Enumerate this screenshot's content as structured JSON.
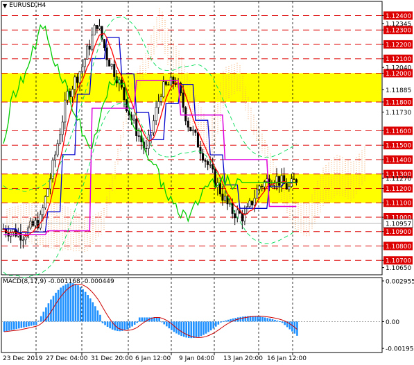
{
  "header": {
    "symbol_label": "EURUSD,H4",
    "dropdown_icon": "triangle-down-icon"
  },
  "price_axis": {
    "ymin": 1.106,
    "ymax": 1.1246,
    "levels": [
      1.124,
      1.123,
      1.122,
      1.121,
      1.12,
      1.118,
      1.116,
      1.115,
      1.114,
      1.113,
      1.112,
      1.111,
      1.11,
      1.109,
      1.108,
      1.107
    ],
    "level_labels": [
      "1.12400",
      "1.12300",
      "1.12200",
      "1.12100",
      "1.12000",
      "1.11800",
      "1.11600",
      "1.11500",
      "1.11400",
      "1.11300",
      "1.11200",
      "1.11100",
      "1.11000",
      "1.10900",
      "1.10800",
      "1.10700"
    ],
    "plain_ticks": [
      1.12345,
      1.1204,
      1.11885,
      1.1173,
      1.1127,
      1.1065
    ],
    "plain_tick_labels": [
      "1.12345",
      "1.12040",
      "1.11885",
      "1.11730",
      "1.11270",
      "1.10650"
    ],
    "current_price": 1.10957,
    "current_price_label": "1.10957"
  },
  "zones": [
    {
      "from": 1.118,
      "to": 1.12,
      "color": "#ffff00"
    },
    {
      "from": 1.111,
      "to": 1.113,
      "color": "#ffff00"
    }
  ],
  "time_axis": {
    "labels": [
      "23 Dec 2019",
      "27 Dec 04:00",
      "31 Dec 20:00",
      "6 Jan 12:00",
      "9 Jan 04:00",
      "13 Jan 20:00",
      "16 Jan 12:00"
    ]
  },
  "macd": {
    "label": "MACD(8,17,9) -0.001168 -0.000449",
    "ymin": -0.00205,
    "ymax": 0.003,
    "ticks": [
      0.002955,
      0.0,
      -0.001955
    ],
    "tick_labels": [
      "0.002955",
      "0.00",
      "-0.001955"
    ]
  },
  "colors": {
    "level_line": "#dd0000",
    "level_label_bg": "#dd0000",
    "candle": "#000000",
    "ma_red": "#ff0000",
    "ma_blue": "#0000cc",
    "ma_green": "#00cc00",
    "ma_magenta": "#dd00dd",
    "bands": "#00dd55",
    "cloud": "#f4a460",
    "histogram": "#1e90ff",
    "macd_signal": "#cc0000"
  }
}
